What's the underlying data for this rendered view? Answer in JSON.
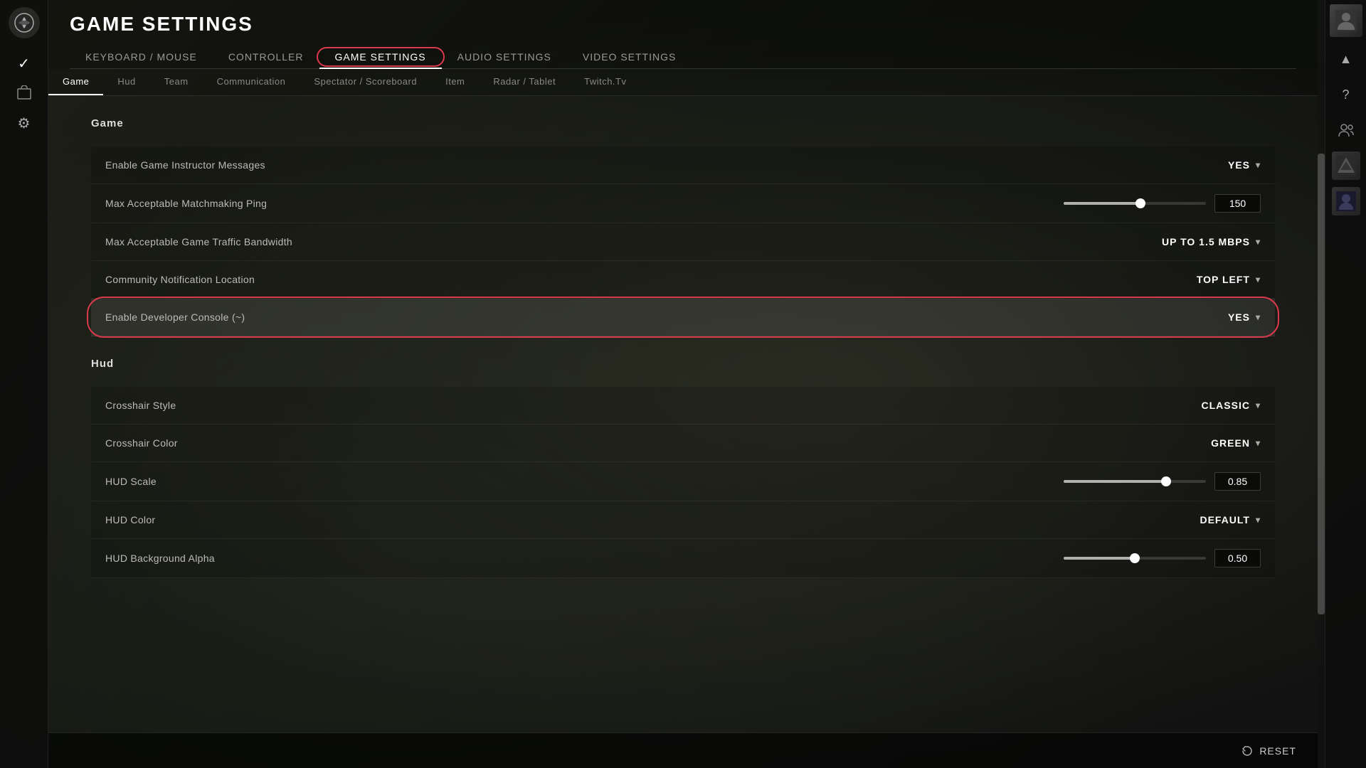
{
  "page": {
    "title": "GAME SETTINGS"
  },
  "mainNav": {
    "items": [
      {
        "id": "keyboard-mouse",
        "label": "Keyboard / Mouse",
        "active": false,
        "highlighted": false
      },
      {
        "id": "controller",
        "label": "Controller",
        "active": false,
        "highlighted": false
      },
      {
        "id": "game-settings",
        "label": "Game Settings",
        "active": true,
        "highlighted": true
      },
      {
        "id": "audio-settings",
        "label": "Audio Settings",
        "active": false,
        "highlighted": false
      },
      {
        "id": "video-settings",
        "label": "Video Settings",
        "active": false,
        "highlighted": false
      }
    ]
  },
  "subNav": {
    "items": [
      {
        "id": "game",
        "label": "Game",
        "active": true
      },
      {
        "id": "hud",
        "label": "Hud",
        "active": false
      },
      {
        "id": "team",
        "label": "Team",
        "active": false
      },
      {
        "id": "communication",
        "label": "Communication",
        "active": false
      },
      {
        "id": "spectator-scoreboard",
        "label": "Spectator / Scoreboard",
        "active": false
      },
      {
        "id": "item",
        "label": "Item",
        "active": false
      },
      {
        "id": "radar-tablet",
        "label": "Radar / Tablet",
        "active": false
      },
      {
        "id": "twitchtv",
        "label": "Twitch.tv",
        "active": false
      }
    ]
  },
  "gameSectionTitle": "Game",
  "gameSettings": [
    {
      "id": "game-instructor-messages",
      "label": "Enable Game Instructor Messages",
      "controlType": "dropdown",
      "value": "YES",
      "highlighted": false
    },
    {
      "id": "matchmaking-ping",
      "label": "Max Acceptable Matchmaking Ping",
      "controlType": "slider",
      "sliderPercent": 54,
      "value": "150",
      "highlighted": false
    },
    {
      "id": "game-traffic-bandwidth",
      "label": "Max Acceptable Game Traffic Bandwidth",
      "controlType": "dropdown",
      "value": "UP TO 1.5 MBPS",
      "highlighted": false
    },
    {
      "id": "community-notification-location",
      "label": "Community Notification Location",
      "controlType": "dropdown",
      "value": "TOP LEFT",
      "highlighted": false
    },
    {
      "id": "developer-console",
      "label": "Enable Developer Console (~)",
      "controlType": "dropdown",
      "value": "YES",
      "highlighted": true
    }
  ],
  "hudSectionTitle": "Hud",
  "hudSettings": [
    {
      "id": "crosshair-style",
      "label": "Crosshair Style",
      "controlType": "dropdown",
      "value": "CLASSIC",
      "highlighted": false
    },
    {
      "id": "crosshair-color",
      "label": "Crosshair Color",
      "controlType": "dropdown",
      "value": "GREEN",
      "highlighted": false
    },
    {
      "id": "hud-scale",
      "label": "HUD Scale",
      "controlType": "slider",
      "sliderPercent": 72,
      "value": "0.85",
      "highlighted": false
    },
    {
      "id": "hud-color",
      "label": "HUD Color",
      "controlType": "dropdown",
      "value": "DEFAULT",
      "highlighted": false
    },
    {
      "id": "hud-background-alpha",
      "label": "HUD Background Alpha",
      "controlType": "slider",
      "sliderPercent": 50,
      "value": "0.50",
      "highlighted": false
    }
  ],
  "bottomBar": {
    "resetLabel": "RESET"
  },
  "rightSidebar": {
    "avatarIcon": "👤",
    "icons": [
      "▲",
      "?",
      "👤",
      "🎮",
      "🦸"
    ]
  }
}
